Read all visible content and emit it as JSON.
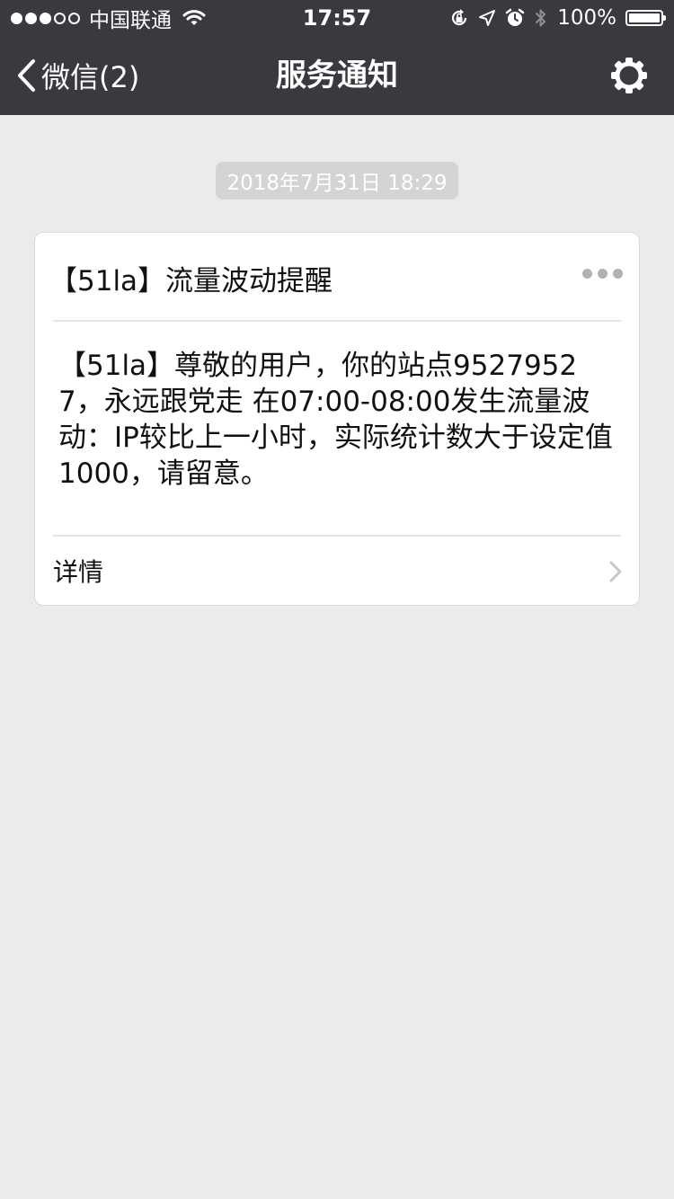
{
  "status_bar": {
    "carrier": "中国联通",
    "time": "17:57",
    "battery": "100%",
    "battery_level": 1.0
  },
  "nav": {
    "back_label": "微信(2)",
    "title": "服务通知"
  },
  "messages": [
    {
      "timestamp": "2018年7月31日 18:29",
      "title": "【51la】流量波动提醒",
      "body": "【51la】尊敬的用户，你的站点95279527，永远跟党走 在07:00-08:00发生流量波动：IP较比上一小时，实际统计数大于设定值1000，请留意。",
      "detail_label": "详情"
    }
  ],
  "colors": {
    "nav_background": "#393a3f",
    "page_background": "#ebebeb",
    "card_background": "#ffffff"
  }
}
